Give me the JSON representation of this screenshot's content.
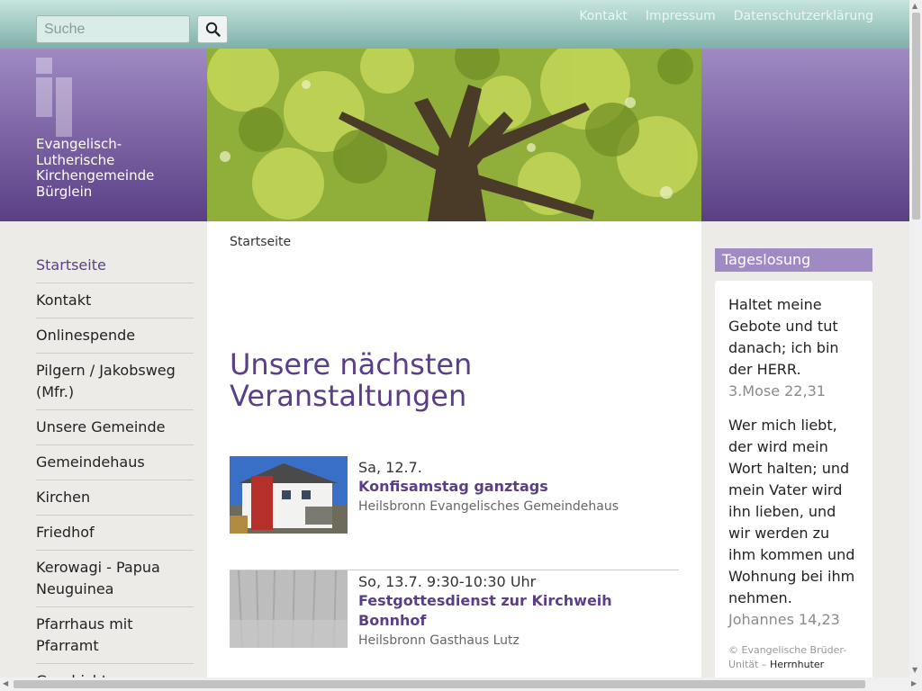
{
  "search": {
    "placeholder": "Suche"
  },
  "top_links": [
    "Kontakt",
    "Impressum",
    "Datenschutzerklärung"
  ],
  "org": {
    "name": "Evangelisch-Lutherische Kirchengemeinde Bürglein"
  },
  "breadcrumb": "Startseite",
  "nav": {
    "items": [
      "Startseite",
      "Kontakt",
      "Onlinespende",
      "Pilgern / Jakobsweg (Mfr.)",
      "Unsere Gemeinde",
      "Gemeindehaus",
      "Kirchen",
      "Friedhof",
      "Kerowagi - Papua Neuguinea",
      "Pfarrhaus mit Pfarramt",
      "Geschichte"
    ],
    "active": "Startseite"
  },
  "section_title": "Unsere nächsten Veranstaltungen",
  "events": [
    {
      "date": "Sa, 12.7.",
      "title": "Konfisamstag ganztags",
      "place": "Heilsbronn Evangelisches Gemeindehaus"
    },
    {
      "date": "So, 13.7. 9:30-10:30 Uhr",
      "title": "Festgottesdienst zur Kirchweih Bonnhof",
      "place": "Heilsbronn Gasthaus Lutz"
    }
  ],
  "losung": {
    "heading": "Tageslosung",
    "verse1": "Haltet meine Gebote und tut danach; ich bin der HERR.",
    "ref1": "3.Mose 22,31",
    "verse2": "Wer mich liebt, der wird mein Wort halten; und mein Vater wird ihn lieben, und wir werden zu ihm kommen und Wohnung bei ihm nehmen.",
    "ref2": "Johannes 14,23",
    "copyright_prefix": "© Evangelische Brüder-Unität – ",
    "copyright_link": "Herrnhuter"
  },
  "colors": {
    "brand_purple": "#5a3f86",
    "header_light": "#9f8ac3",
    "teal": "#7fb0a8"
  }
}
